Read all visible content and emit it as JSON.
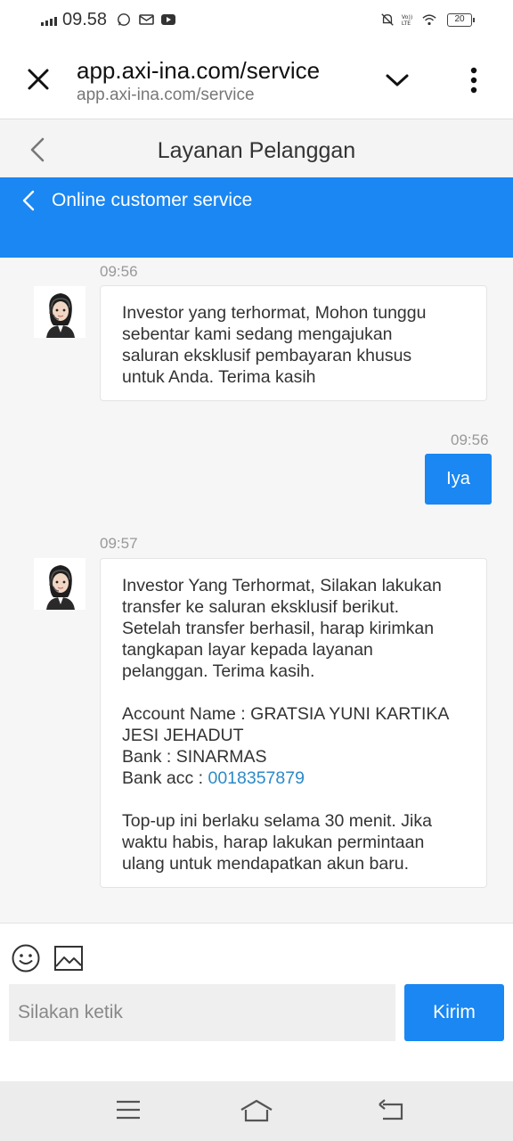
{
  "status_bar": {
    "time": "09.58",
    "network_label": "VoLTE",
    "battery": "20",
    "icons": [
      "signal-icon",
      "whatsapp-icon",
      "message-icon",
      "youtube-icon",
      "mute-icon",
      "volte-icon",
      "wifi-icon",
      "battery-icon"
    ]
  },
  "browser": {
    "title": "app.axi-ina.com/service",
    "url": "app.axi-ina.com/service"
  },
  "page_header": {
    "title": "Layanan Pelanggan"
  },
  "service_bar": {
    "title": "Online customer service"
  },
  "messages": [
    {
      "time": "09:56",
      "from": "agent",
      "lines": [
        "Investor yang terhormat, Mohon tunggu",
        "sebentar kami sedang mengajukan",
        "saluran eksklusif pembayaran khusus",
        "untuk Anda. Terima kasih"
      ]
    },
    {
      "time": "09:56",
      "from": "user",
      "text": "Iya"
    },
    {
      "time": "09:57",
      "from": "agent",
      "intro": [
        "Investor Yang Terhormat, Silakan lakukan",
        "transfer ke saluran eksklusif berikut.",
        "Setelah transfer berhasil, harap kirimkan",
        "tangkapan layar kepada layanan",
        "pelanggan. Terima kasih."
      ],
      "account_name_line1": "Account Name : GRATSIA YUNI KARTIKA",
      "account_name_line2": "JESI JEHADUT",
      "bank": "Bank : SINARMAS",
      "bank_acc_label": "Bank acc : ",
      "bank_acc_number": "0018357879",
      "outro": [
        "Top-up ini berlaku selama 30 menit. Jika",
        "waktu habis, harap lakukan permintaan",
        "ulang untuk mendapatkan akun baru."
      ]
    }
  ],
  "composer": {
    "placeholder": "Silakan ketik",
    "send_label": "Kirim"
  },
  "colors": {
    "accent": "#1a87f2",
    "link": "#2c8ac9"
  }
}
